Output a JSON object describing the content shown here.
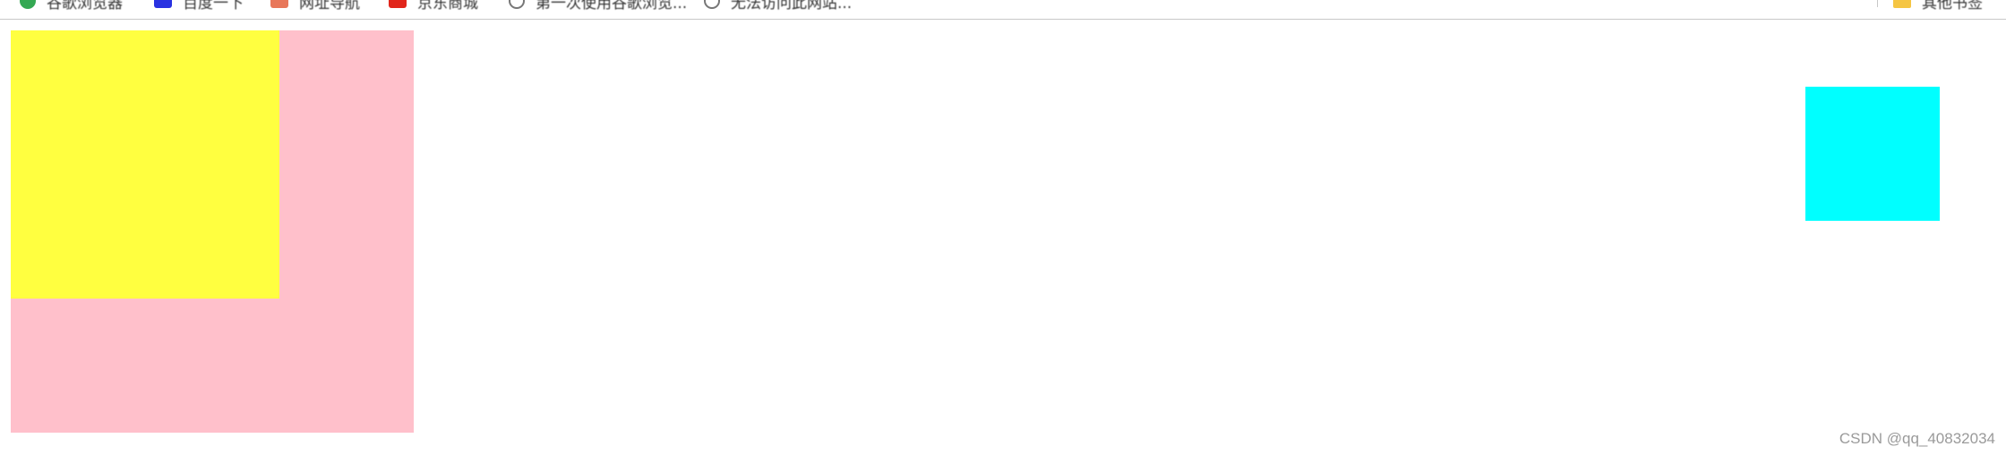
{
  "bookmarks": {
    "items": [
      {
        "label": "谷歌浏览器",
        "icon": "chrome-icon",
        "color": "#34a853"
      },
      {
        "label": "百度一下",
        "icon": "baidu-icon",
        "color": "#2932e1"
      },
      {
        "label": "网址导航",
        "icon": "colorful-icon",
        "color": "#e8775a"
      },
      {
        "label": "京东商城",
        "icon": "jd-icon",
        "color": "#e1251b"
      },
      {
        "label": "第一次使用谷歌浏览...",
        "icon": "globe-icon",
        "color": "#777777"
      },
      {
        "label": "无法访问此网站...",
        "icon": "globe-icon",
        "color": "#777777"
      }
    ],
    "other": {
      "label": "其他书签",
      "icon": "folder-icon"
    }
  },
  "colors": {
    "pink": "#ffc0cb",
    "yellow": "#ffff40",
    "cyan": "#00ffff"
  },
  "watermark": "CSDN @qq_40832034"
}
